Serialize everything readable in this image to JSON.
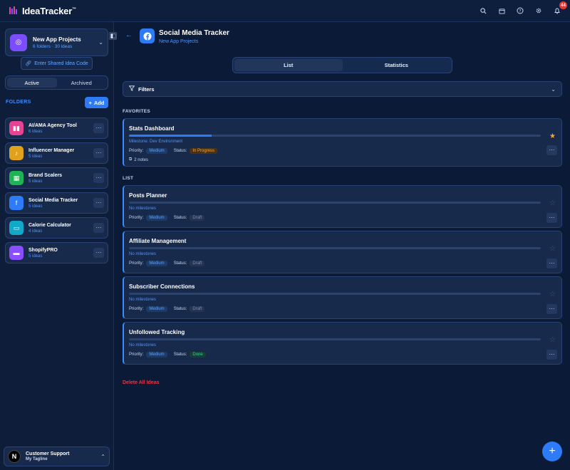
{
  "app": {
    "name": "IdeaTracker",
    "trademark": "™",
    "notification_count": "44"
  },
  "sidebar": {
    "project": {
      "name": "New App Projects",
      "meta": "6 folders · 30 ideas"
    },
    "shared_code_label": "Enter Shared Idea Code",
    "segments": [
      "Active",
      "Archived"
    ],
    "folders_heading": "FOLDERS",
    "add_label": "Add",
    "folders": [
      {
        "name": "AI/AMA Agency Tool",
        "count": "6 ideas",
        "color": "#e84393",
        "icon": "chart-icon"
      },
      {
        "name": "Influencer Manager",
        "count": "5 ideas",
        "color": "#e0a21b",
        "icon": "tiktok-icon"
      },
      {
        "name": "Brand Scalers",
        "count": "5 ideas",
        "color": "#1fb355",
        "icon": "calculator-icon"
      },
      {
        "name": "Social Media Tracker",
        "count": "5 ideas",
        "color": "#2d7bf6",
        "icon": "facebook-icon"
      },
      {
        "name": "Calorie Calculator",
        "count": "4 ideas",
        "color": "#12a8c9",
        "icon": "folder-icon"
      },
      {
        "name": "ShopifyPRO",
        "count": "5 ideas",
        "color": "#8a4dff",
        "icon": "card-icon"
      }
    ],
    "support": {
      "name": "Customer Support",
      "tagline": "My Tagline",
      "avatar_letter": "N"
    }
  },
  "main": {
    "title": "Social Media Tracker",
    "subtitle": "New App Projects",
    "tabs": [
      "List",
      "Statistics"
    ],
    "filters_label": "Filters",
    "favorites_heading": "FAVORITES",
    "list_heading": "LIST",
    "priority_label": "Priority:",
    "status_label": "Status:",
    "favorites": [
      {
        "title": "Stats Dashboard",
        "milestone": "Milestone: Dev Environment",
        "priority": "Medium",
        "status": "In Progress",
        "notes": "2 notes",
        "progress": 0.2
      }
    ],
    "ideas": [
      {
        "title": "Posts Planner",
        "milestone": "No milestones",
        "priority": "Medium",
        "status": "Draft",
        "progress": 0
      },
      {
        "title": "Affiliate Management",
        "milestone": "No milestones",
        "priority": "Medium",
        "status": "Draft",
        "progress": 0
      },
      {
        "title": "Subscriber Connections",
        "milestone": "No milestones",
        "priority": "Medium",
        "status": "Draft",
        "progress": 0
      },
      {
        "title": "Unfollowed Tracking",
        "milestone": "No milestones",
        "priority": "Medium",
        "status": "Done",
        "progress": 0
      }
    ],
    "delete_all_label": "Delete All Ideas"
  }
}
